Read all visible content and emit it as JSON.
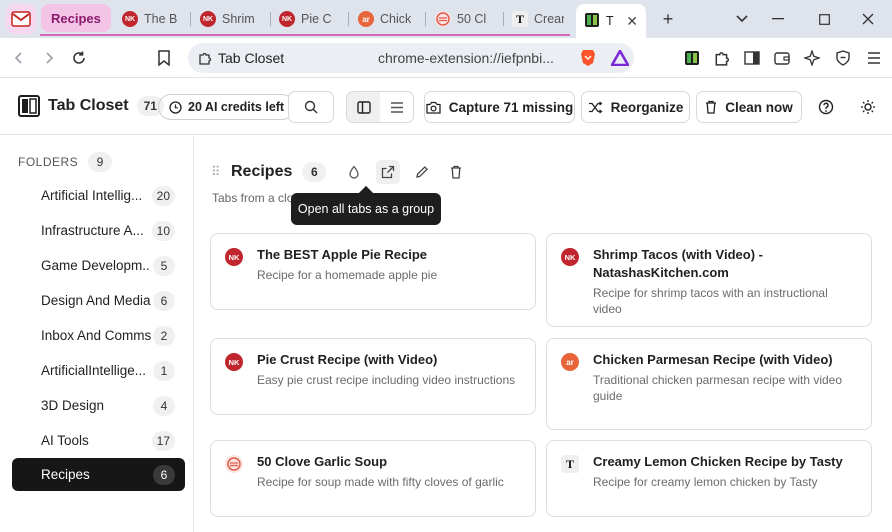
{
  "browser": {
    "tab_group_label": "Recipes",
    "tabs": [
      {
        "label": "The B",
        "favicon": "NK"
      },
      {
        "label": "Shrim",
        "favicon": "NK"
      },
      {
        "label": "Pie C",
        "favicon": "NK"
      },
      {
        "label": "Chick",
        "favicon": "ar"
      },
      {
        "label": "50 Cl",
        "favicon": "soup-icon"
      },
      {
        "label": "Crean",
        "favicon": "T"
      },
      {
        "label": "T",
        "favicon": "tab-closet-icon"
      }
    ],
    "omnibox_site": "Tab Closet",
    "omnibox_url": "chrome-extension://iefpnbi..."
  },
  "header": {
    "title": "Tab Closet",
    "tab_count": "71",
    "credits": "20 AI credits left",
    "capture_label": "Capture 71 missing",
    "reorganize_label": "Reorganize",
    "clean_label": "Clean now"
  },
  "sidebar": {
    "heading": "FOLDERS",
    "folder_count": "9",
    "folders": [
      {
        "name": "Artificial Intellig...",
        "count": "20"
      },
      {
        "name": "Infrastructure A...",
        "count": "10"
      },
      {
        "name": "Game Developm...",
        "count": "5"
      },
      {
        "name": "Design And Media",
        "count": "6"
      },
      {
        "name": "Inbox And Comms",
        "count": "2"
      },
      {
        "name": "ArtificialIntellige...",
        "count": "1"
      },
      {
        "name": "3D Design",
        "count": "4"
      },
      {
        "name": "AI Tools",
        "count": "17"
      },
      {
        "name": "Recipes",
        "count": "6"
      }
    ]
  },
  "group": {
    "title": "Recipes",
    "count": "6",
    "description": "Tabs from a clo",
    "tooltip": "Open all tabs as a group"
  },
  "cards": [
    {
      "title": "The BEST Apple Pie Recipe",
      "desc": "Recipe for a homemade apple pie",
      "favicon": "NK"
    },
    {
      "title": "Shrimp Tacos (with Video) - NatashasKitchen.com",
      "desc": "Recipe for shrimp tacos with an instructional video",
      "favicon": "NK"
    },
    {
      "title": "Pie Crust Recipe (with Video)",
      "desc": "Easy pie crust recipe including video instructions",
      "favicon": "NK"
    },
    {
      "title": "Chicken Parmesan Recipe (with Video)",
      "desc": "Traditional chicken parmesan recipe with video guide",
      "favicon": "ar"
    },
    {
      "title": "50 Clove Garlic Soup",
      "desc": "Recipe for soup made with fifty cloves of garlic",
      "favicon": "soup-icon"
    },
    {
      "title": "Creamy Lemon Chicken Recipe by Tasty",
      "desc": "Recipe for creamy lemon chicken by Tasty",
      "favicon": "T"
    }
  ],
  "colors": {
    "tab_group": "#d46ab5",
    "selected_folder": "#161616",
    "tooltip": "#1e1e1e"
  }
}
